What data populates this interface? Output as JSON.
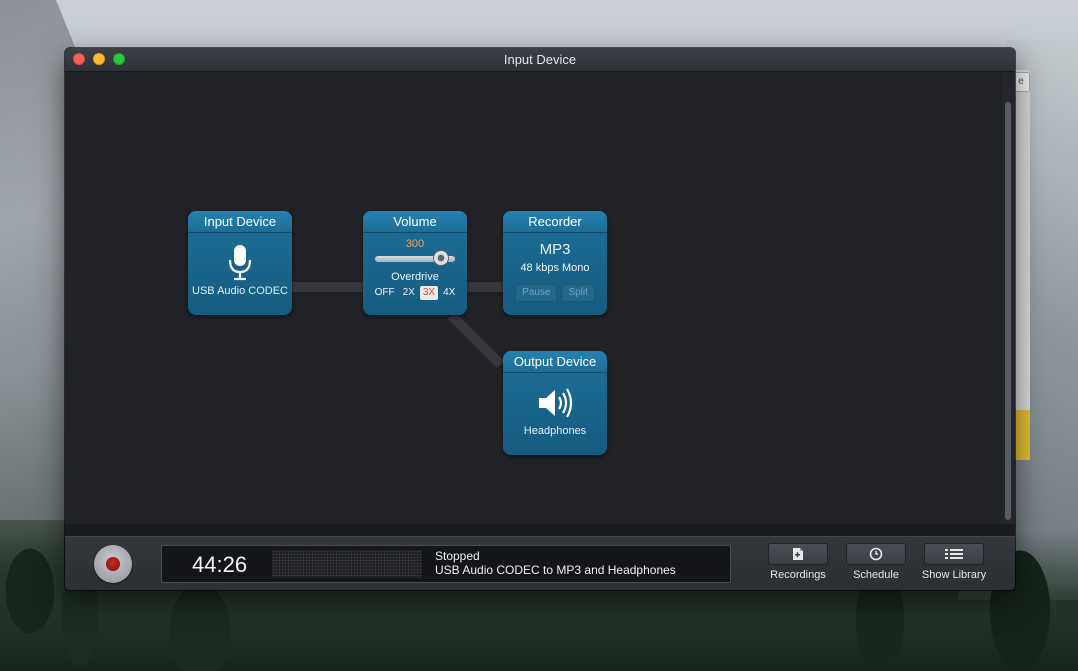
{
  "window": {
    "title": "Input Device"
  },
  "background_window": {
    "tab_label": "e"
  },
  "modules": {
    "input": {
      "header": "Input Device",
      "device_name": "USB Audio CODEC",
      "icon": "microphone-icon"
    },
    "volume": {
      "header": "Volume",
      "value": "300",
      "level_fraction": 0.82,
      "overdrive_label": "Overdrive",
      "overdrive_options": [
        "OFF",
        "2X",
        "3X",
        "4X"
      ],
      "overdrive_selected": "3X"
    },
    "recorder": {
      "header": "Recorder",
      "format": "MP3",
      "bitrate": "48 kbps Mono",
      "pause_label": "Pause",
      "split_label": "Split"
    },
    "output": {
      "header": "Output Device",
      "device_name": "Headphones",
      "icon": "speaker-icon"
    }
  },
  "status_bar": {
    "elapsed": "44:26",
    "state": "Stopped",
    "route": "USB Audio CODEC to MP3 and Headphones",
    "recordings_label": "Recordings",
    "schedule_label": "Schedule",
    "library_label": "Show Library"
  },
  "colors": {
    "module_blue": "#1e6f99",
    "volume_value": "#f4a259",
    "overdrive_active_text": "#d9502f",
    "record_red": "#c62a1f"
  }
}
